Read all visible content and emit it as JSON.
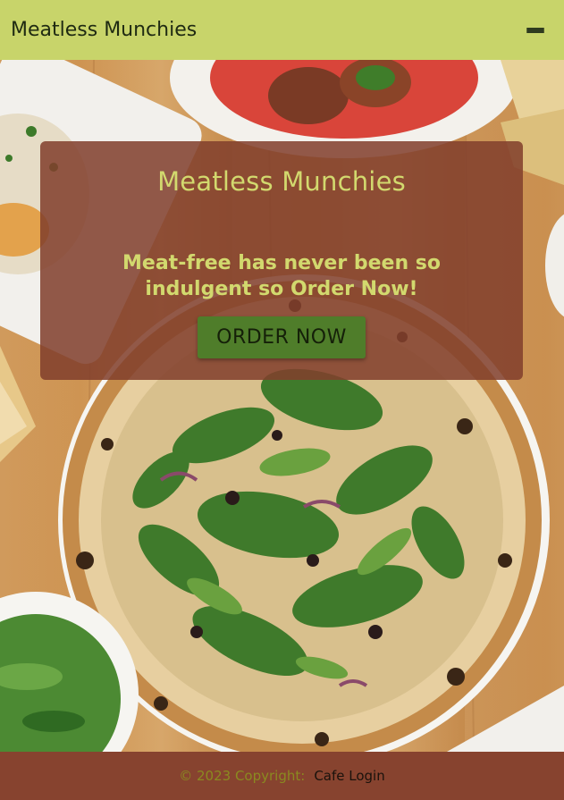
{
  "navbar": {
    "brand": "Meatless Munchies",
    "menu_icon": "hamburger-menu-icon"
  },
  "hero": {
    "image": "pizza-and-dishes-photo",
    "title": "Meatless Munchies",
    "tagline": "Meat-free has never been so indulgent so Order Now!",
    "button_label": "ORDER NOW"
  },
  "footer": {
    "copyright": "© 2023 Copyright:",
    "login_link": "Cafe Login"
  },
  "colors": {
    "navbar_bg": "#c8d46a",
    "card_bg": "#813f2c",
    "accent_text": "#d2d96e",
    "button_bg": "#4f7d2a",
    "footer_bg": "#87432f"
  }
}
